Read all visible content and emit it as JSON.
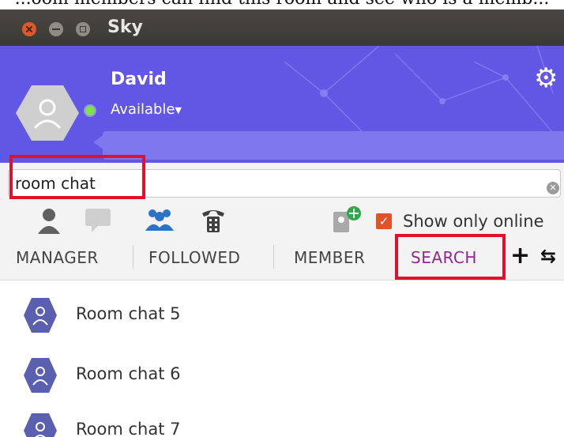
{
  "caption": "...oom members can find this room and see who is a memb...",
  "window": {
    "title": "Sky"
  },
  "user": {
    "name": "David",
    "status": "Available"
  },
  "search": {
    "value": "room chat"
  },
  "filters": {
    "show_only_online_label": "Show only online",
    "show_only_online_checked": true
  },
  "tabs": [
    {
      "label": "MANAGER",
      "active": false
    },
    {
      "label": "FOLLOWED",
      "active": false
    },
    {
      "label": "MEMBER",
      "active": false
    },
    {
      "label": "SEARCH",
      "active": true
    }
  ],
  "rooms": [
    {
      "name": "Room chat 5"
    },
    {
      "name": "Room chat 6"
    },
    {
      "name": "Room chat 7"
    }
  ],
  "colors": {
    "header_bg": "#6257e4",
    "active_tab": "#8e2a8f",
    "highlight_box": "#e0122b",
    "room_avatar": "#5a5fb0",
    "online_dot": "#7ee24a"
  },
  "icons": {
    "settings": "gear-icon",
    "contacts": "person-icon",
    "chat": "chat-bubble-icon",
    "groups": "group-icon",
    "phone": "phone-icon",
    "add_contact": "add-contact-icon",
    "add": "plus-icon",
    "more": "more-icon",
    "clear": "clear-icon"
  }
}
